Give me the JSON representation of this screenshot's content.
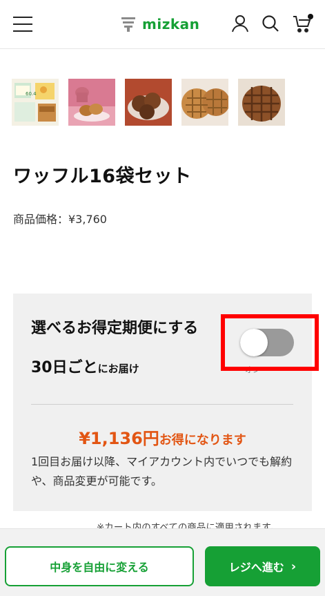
{
  "header": {
    "brand": "mizkan",
    "icons": [
      "menu-icon",
      "account-icon",
      "search-icon",
      "cart-icon"
    ],
    "brand_color": "#16a035"
  },
  "gallery": {
    "thumbnails": [
      "product-set-image",
      "waffles-with-tea-image",
      "waffles-on-plate-image",
      "waffles-closeup-image",
      "waffle-single-image"
    ]
  },
  "product": {
    "title": "ワッフル16袋セット",
    "price_label": "商品価格：¥3,760"
  },
  "subscription": {
    "heading": "選べるお得定期便にする",
    "interval": "30日ごと",
    "interval_suffix": "にお届け",
    "toggle_on": false,
    "toggle_label": "オン",
    "savings_amount": "¥1,136円",
    "savings_text": "お得になります",
    "description": "1回目お届け以降、マイアカウント内でいつでも解約や、商品変更が可能です。",
    "accent_color": "#e25513"
  },
  "note": "※カート内のすべての商品に適用されます。",
  "actions": {
    "customize_label": "中身を自由に変える",
    "checkout_label": "レジへ進む",
    "checkout_chevron": "›"
  }
}
